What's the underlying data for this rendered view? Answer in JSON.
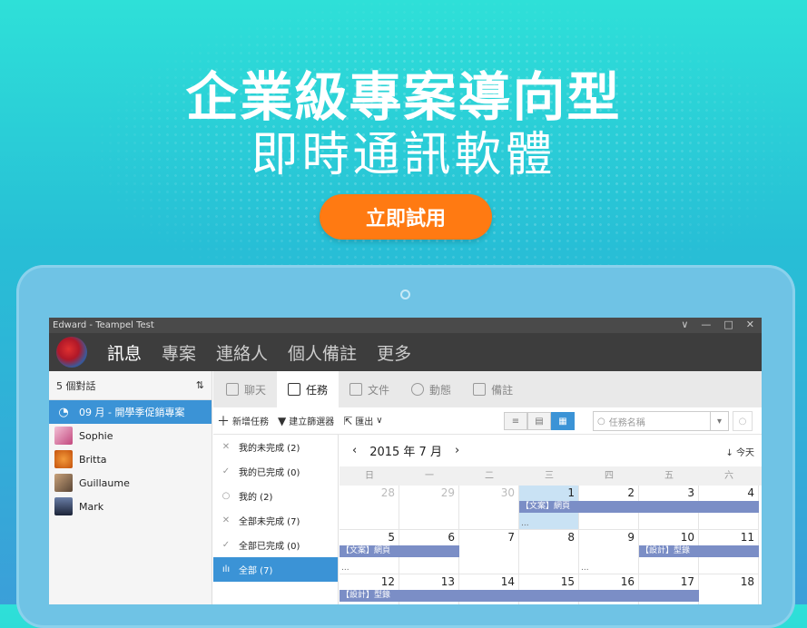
{
  "banner": {
    "headline": "企業級專案導向型",
    "subheadline": "即時通訊軟體",
    "cta_label": "立即試用",
    "cta_color": "#ff7a12"
  },
  "window": {
    "title": "Edward - Teampel Test",
    "controls": [
      "∨",
      "—",
      "□",
      "✕"
    ]
  },
  "nav": {
    "items": [
      "訊息",
      "專案",
      "連絡人",
      "個人備註",
      "更多"
    ],
    "active": "訊息"
  },
  "sidebar": {
    "count_label": "5 個對話",
    "sort_icon": "sort-icon",
    "conversations": [
      {
        "label": "09 月 - 開學季促銷專案",
        "selected": true,
        "icon": "chat-bubble-icon"
      },
      {
        "label": "Sophie",
        "selected": false,
        "color": "#d86aa0"
      },
      {
        "label": "Britta",
        "selected": false,
        "color": "#e46f1f"
      },
      {
        "label": "Guillaume",
        "selected": false,
        "color": "#8a6f5a"
      },
      {
        "label": "Mark",
        "selected": false,
        "color": "#2b3a5a"
      }
    ]
  },
  "tabs": [
    {
      "label": "聊天",
      "icon": "chat-icon",
      "active": false
    },
    {
      "label": "任務",
      "icon": "task-icon",
      "active": true
    },
    {
      "label": "文件",
      "icon": "file-icon",
      "active": false
    },
    {
      "label": "動態",
      "icon": "info-icon",
      "active": false
    },
    {
      "label": "備註",
      "icon": "note-icon",
      "active": false
    }
  ],
  "toolbar": {
    "add_task": "新增任務",
    "create_filter": "建立篩選器",
    "export": "匯出",
    "search_placeholder": "任務名稱"
  },
  "filters": [
    {
      "label": "我的未完成 (2)",
      "icon": "x-person-icon",
      "selected": false
    },
    {
      "label": "我的已完成 (0)",
      "icon": "check-person-icon",
      "selected": false
    },
    {
      "label": "我的 (2)",
      "icon": "person-icon",
      "selected": false
    },
    {
      "label": "全部未完成 (7)",
      "icon": "x-icon",
      "selected": false
    },
    {
      "label": "全部已完成 (0)",
      "icon": "check-icon",
      "selected": false
    },
    {
      "label": "全部 (7)",
      "icon": "chart-icon",
      "selected": true
    }
  ],
  "calendar": {
    "month_label": "2015 年 7 月",
    "today_label": "今天",
    "weekdays": [
      "日",
      "一",
      "二",
      "三",
      "四",
      "五",
      "六"
    ],
    "weeks": [
      [
        {
          "d": "28",
          "other": true
        },
        {
          "d": "29",
          "other": true
        },
        {
          "d": "30",
          "other": true
        },
        {
          "d": "1",
          "hl": true,
          "dots": true
        },
        {
          "d": "2"
        },
        {
          "d": "3"
        },
        {
          "d": "4"
        }
      ],
      [
        {
          "d": "5",
          "dots": true
        },
        {
          "d": "6"
        },
        {
          "d": "7"
        },
        {
          "d": "8"
        },
        {
          "d": "9",
          "dots": true
        },
        {
          "d": "10"
        },
        {
          "d": "11"
        }
      ],
      [
        {
          "d": "12"
        },
        {
          "d": "13"
        },
        {
          "d": "14"
        },
        {
          "d": "15"
        },
        {
          "d": "16"
        },
        {
          "d": "17"
        },
        {
          "d": "18"
        }
      ]
    ],
    "events": [
      {
        "label": "【文案】網頁",
        "week": 0,
        "start": 3,
        "end": 6
      },
      {
        "label": "【文案】網頁",
        "week": 1,
        "start": 0,
        "end": 1
      },
      {
        "label": "【設計】型錄",
        "week": 1,
        "start": 5,
        "end": 6
      },
      {
        "label": "【設計】型錄",
        "week": 2,
        "start": 0,
        "end": 5
      }
    ]
  }
}
